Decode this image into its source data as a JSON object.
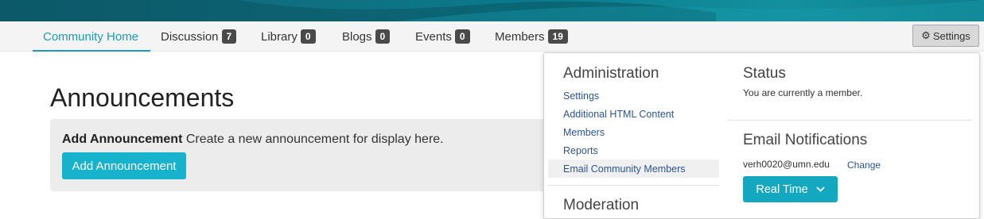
{
  "nav": {
    "tabs": [
      {
        "label": "Community Home",
        "badge": null
      },
      {
        "label": "Discussion",
        "badge": "7"
      },
      {
        "label": "Library",
        "badge": "0"
      },
      {
        "label": "Blogs",
        "badge": "0"
      },
      {
        "label": "Events",
        "badge": "0"
      },
      {
        "label": "Members",
        "badge": "19"
      }
    ],
    "settings_label": "Settings"
  },
  "main": {
    "title": "Announcements",
    "add_bold": "Add Announcement",
    "add_desc": "Create a new announcement for display here.",
    "add_button": "Add Announcement"
  },
  "dropdown": {
    "admin_heading": "Administration",
    "admin_links": [
      "Settings",
      "Additional HTML Content",
      "Members",
      "Reports",
      "Email Community Members"
    ],
    "moderation_heading": "Moderation",
    "status_heading": "Status",
    "status_text": "You are currently a member.",
    "email_heading": "Email Notifications",
    "email": "verh0020@umn.edu",
    "change_label": "Change",
    "frequency": "Real Time"
  },
  "colors": {
    "accent": "#1a9bb5",
    "button": "#17b2cc",
    "link": "#2a5594",
    "banner": "#0f6f80"
  }
}
